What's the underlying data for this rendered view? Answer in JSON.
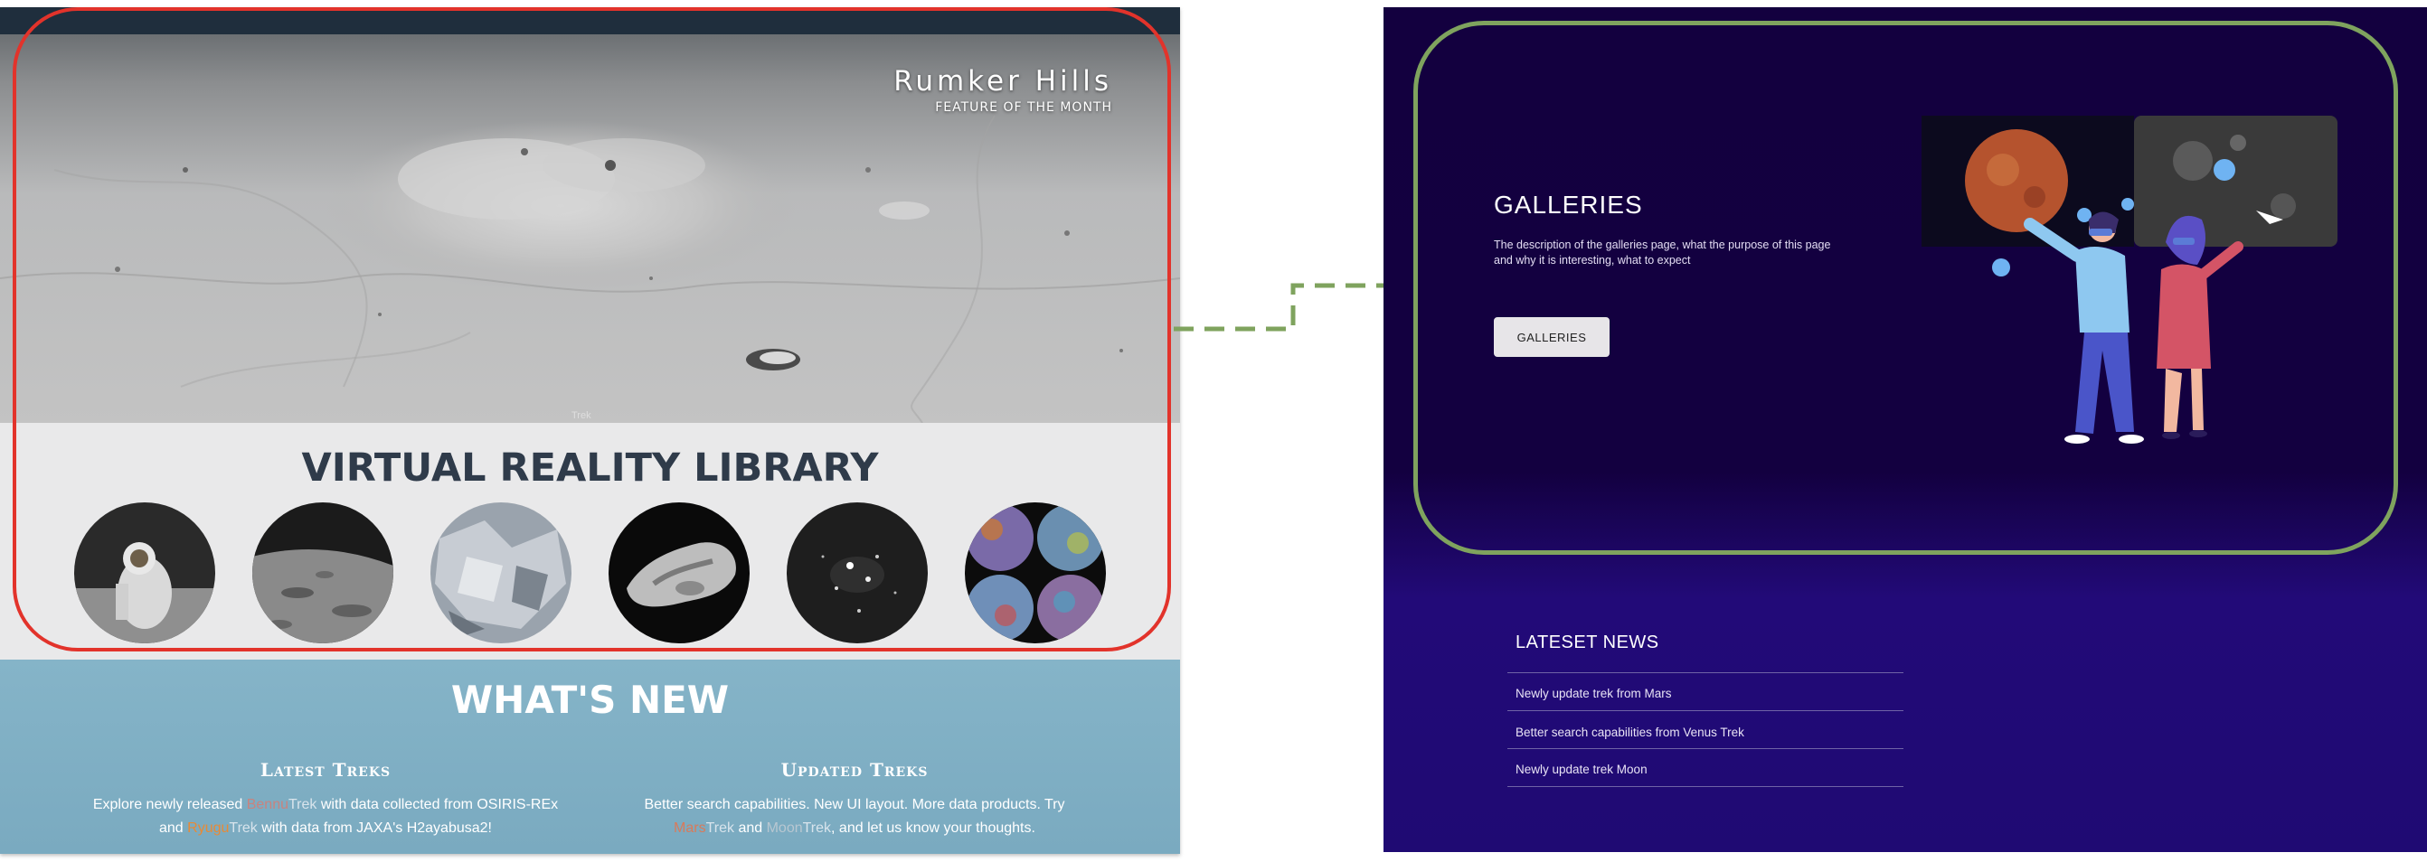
{
  "left_panel": {
    "feature": {
      "title": "Rumker Hills",
      "subtitle": "FEATURE OF THE MONTH",
      "watermark": "Trek"
    },
    "library": {
      "title": "VIRTUAL REALITY LIBRARY",
      "thumbnails": [
        {
          "name": "astronaut"
        },
        {
          "name": "lunar-surface"
        },
        {
          "name": "ice-rock"
        },
        {
          "name": "asteroid"
        },
        {
          "name": "star-field"
        },
        {
          "name": "planet-mosaic"
        }
      ]
    },
    "whats_new": {
      "title": "WHAT'S NEW",
      "latest": {
        "heading": "Latest Treks",
        "line1_a": "Explore newly released ",
        "line1_bennu": "Bennu",
        "line1_trek": "Trek",
        "line1_b": " with data collected from OSIRIS-REx",
        "line2_a": "and ",
        "line2_ryugu": "Ryugu",
        "line2_trek": "Trek",
        "line2_b": " with data from JAXA's H2ayabusa2!"
      },
      "updated": {
        "heading": "Updated Treks",
        "line1": "Better search capabilities. New UI layout. More data products. Try",
        "line2_mars": "Mars",
        "line2_trek1": "Trek",
        "line2_and": " and ",
        "line2_moon": "Moon",
        "line2_trek2": "Trek",
        "line2_b": ", and let us know your thoughts."
      }
    },
    "colors": {
      "annotation_red": "#e2332b",
      "whats_new_bg": "#85b4c8",
      "title_dark": "#2f3b4a"
    }
  },
  "right_panel": {
    "galleries": {
      "title": "GALLERIES",
      "description": "The description of the galleries page, what the purpose of this page and why it is interesting, what to expect",
      "button_label": "GALLERIES"
    },
    "news": {
      "title": "LATESET NEWS",
      "items": [
        "Newly update trek from Mars",
        "Better search capabilities from Venus Trek",
        "Newly update trek Moon"
      ]
    },
    "colors": {
      "background": "#13003f",
      "annotation_green": "#7fa35e",
      "button_bg": "#e7e5e8"
    }
  }
}
